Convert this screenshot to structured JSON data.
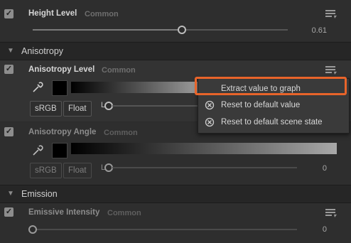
{
  "height_level": {
    "enabled": true,
    "label": "Height Level",
    "tag": "Common",
    "value": "0.61",
    "slider_fraction": 0.61
  },
  "section_anisotropy": {
    "title": "Anisotropy",
    "expanded": true
  },
  "anisotropy_level": {
    "enabled": true,
    "label": "Anisotropy Level",
    "tag": "Common",
    "srgb_label": "sRGB",
    "float_label": "Float",
    "l_label": "L"
  },
  "anisotropy_angle": {
    "enabled": true,
    "label": "Anisotropy Angle",
    "tag": "Common",
    "srgb_label": "sRGB",
    "float_label": "Float",
    "l_label": "L",
    "value": "0"
  },
  "section_emission": {
    "title": "Emission",
    "expanded": true
  },
  "emissive_intensity": {
    "enabled": true,
    "label": "Emissive Intensity",
    "tag": "Common",
    "value": "0"
  },
  "context_menu": {
    "items": [
      {
        "label": "Extract value to graph",
        "icon": "none"
      },
      {
        "label": "Reset to default value",
        "icon": "reset-icon"
      },
      {
        "label": "Reset to default scene state",
        "icon": "reset-icon"
      }
    ]
  },
  "colors": {
    "background": "#2b2b2b",
    "section_header": "#262626",
    "highlight": "#e8642a",
    "menu_bg": "#3a3a3a"
  }
}
